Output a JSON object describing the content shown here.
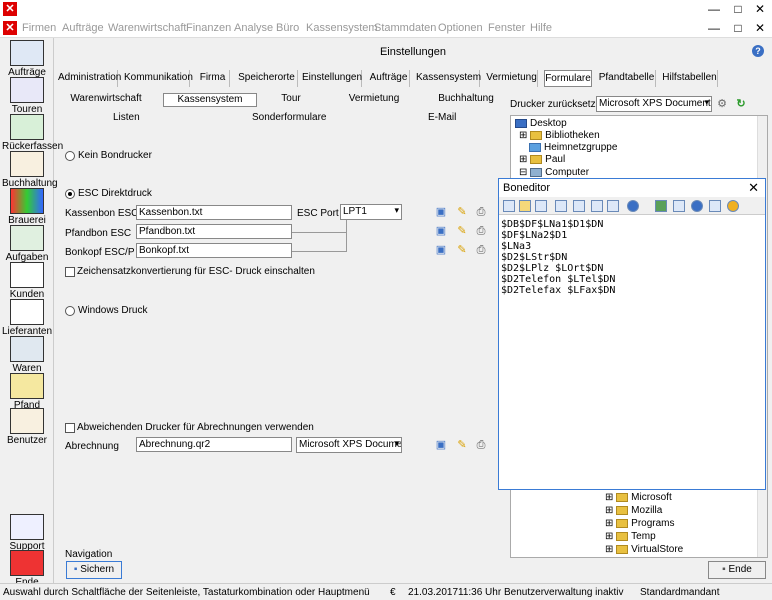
{
  "window": {
    "close_glyph": "✕",
    "minimize_glyph": "—",
    "maximize_glyph": "□"
  },
  "menu": [
    "Firmen",
    "Aufträge",
    "Warenwirtschaft",
    "Finanzen",
    "Analyse",
    "Büro",
    "Kassensystem",
    "Stammdaten",
    "Optionen",
    "Fenster",
    "Hilfe"
  ],
  "sidebar": [
    "Aufträge",
    "Touren",
    "Rückerfassen",
    "Buchhaltung",
    "Brauerei",
    "Aufgaben",
    "Kunden",
    "Lieferanten",
    "Waren",
    "Pfand",
    "Benutzer"
  ],
  "sidebar_bottom": [
    "Support",
    "Ende"
  ],
  "header": {
    "title": "Einstellungen",
    "help": "?"
  },
  "tabs": [
    "Administration",
    "Kommunikation",
    "Firma",
    "Speicherorte",
    "Einstellungen",
    "Aufträge",
    "Kassensystem",
    "Vermietung",
    "Formulare",
    "Pfandtabelle",
    "Hilfstabellen"
  ],
  "subtabs": [
    "Warenwirtschaft",
    "Kassensystem",
    "Tour",
    "Vermietung",
    "Buchhaltung"
  ],
  "subtabs2": [
    "Listen",
    "Sonderformulare",
    "E-Mail"
  ],
  "printer_reset": {
    "label": "Drucker zurücksetzen:",
    "value": "Microsoft XPS Document W"
  },
  "form": {
    "kein_bondrucker": "Kein Bondrucker",
    "esc_direktdruck": "ESC Direktdruck",
    "kassenbon_label": "Kassenbon ESC/P",
    "kassenbon_value": "Kassenbon.txt",
    "pfandbon_label": "Pfandbon ESC",
    "pfandbon_value": "Pfandbon.txt",
    "bonkopf_label": "Bonkopf ESC/P",
    "bonkopf_value": "Bonkopf.txt",
    "esc_port_label": "ESC Port",
    "esc_port_value": "LPT1",
    "zeichensatz": "Zeichensatzkonvertierung für ESC- Druck einschalten",
    "windows_druck": "Windows Druck",
    "abw_drucker": "Abweichenden Drucker für Abrechnungen verwenden",
    "abrechnung_label": "Abrechnung",
    "abrechnung_value": "Abrechnung.qr2",
    "abrechnung_printer": "Microsoft XPS Documer"
  },
  "tree": [
    "Desktop",
    "Bibliotheken",
    "Heimnetzgruppe",
    "Paul",
    "Computer",
    "Microsoft",
    "Mozilla",
    "Programs",
    "Temp",
    "VirtualStore"
  ],
  "editor": {
    "title": "Boneditor",
    "close": "✕",
    "lines": [
      "$DB$DF$LNa1$D1$DN",
      "$DF$LNa2$D1",
      "$LNa3",
      "$D2$LStr$DN",
      "$D2$LPlz $LOrt$DN",
      "$D2Telefon $LTel$DN",
      "$D2Telefax $LFax$DN"
    ]
  },
  "navigation": {
    "label": "Navigation",
    "save": "Sichern",
    "end": "Ende"
  },
  "status": {
    "hint": "Auswahl durch Schaltfläche der Seitenleiste, Tastaturkombination oder Hauptmenü",
    "currency": "€",
    "date": "21.03.2017",
    "time": "11:36 Uhr",
    "info": "Benutzerverwaltung inaktiv",
    "client": "Standardmandant"
  }
}
